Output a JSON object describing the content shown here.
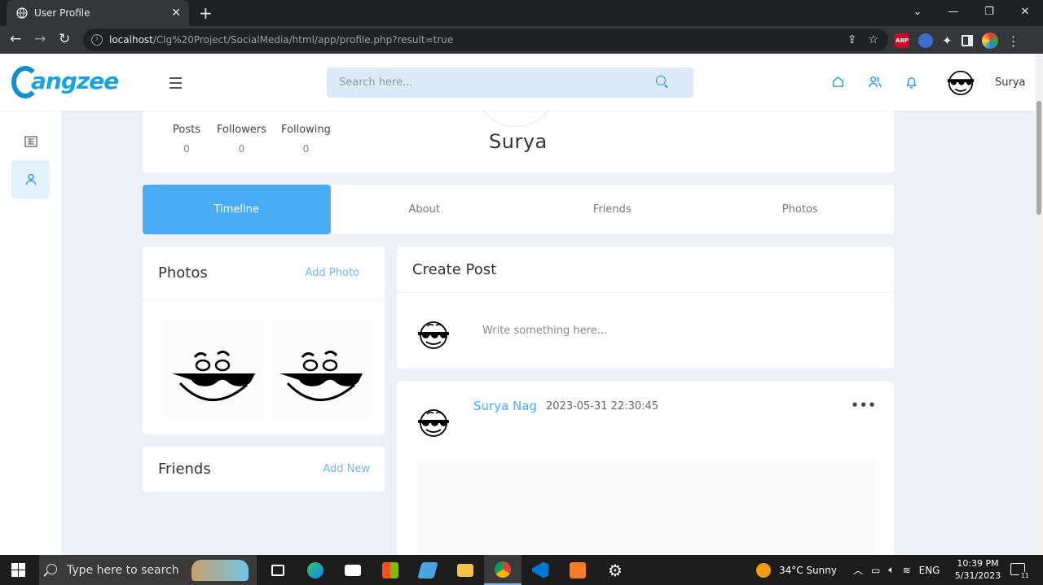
{
  "browser": {
    "tab_title": "User Profile",
    "url_host": "localhost",
    "url_path": "/Clg%20Project/SocialMedia/html/app/profile.php?result=true",
    "abp_label": "ABP"
  },
  "topnav": {
    "logo_text": "angzee",
    "search_placeholder": "Search here...",
    "user_name": "Surya"
  },
  "profile": {
    "name": "Surya",
    "stats": [
      {
        "label": "Posts",
        "value": "0"
      },
      {
        "label": "Followers",
        "value": "0"
      },
      {
        "label": "Following",
        "value": "0"
      }
    ]
  },
  "tabs": [
    {
      "label": "Timeline",
      "active": true
    },
    {
      "label": "About",
      "active": false
    },
    {
      "label": "Friends",
      "active": false
    },
    {
      "label": "Photos",
      "active": false
    }
  ],
  "photos_card": {
    "title": "Photos",
    "action": "Add Photo"
  },
  "friends_card": {
    "title": "Friends",
    "action": "Add New"
  },
  "create_post": {
    "title": "Create Post",
    "placeholder": "Write something here..."
  },
  "post": {
    "author": "Surya Nag",
    "timestamp": "2023-05-31 22:30:45",
    "more": "•••"
  },
  "taskbar": {
    "search_placeholder": "Type here to search",
    "weather": "34°C  Sunny",
    "language": "ENG",
    "time": "10:39 PM",
    "date": "5/31/2023",
    "notification_count": "11"
  },
  "colors": {
    "accent": "#4aabf7",
    "page_bg": "#eef1f5"
  }
}
